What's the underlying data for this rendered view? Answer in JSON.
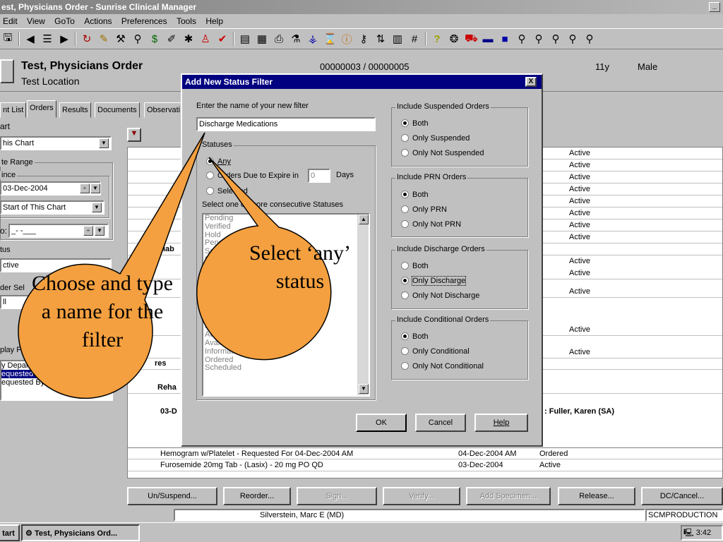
{
  "window": {
    "title": "est, Physicians Order - Sunrise Clinical Manager",
    "close_glyph": "_"
  },
  "menu": [
    "Edit",
    "View",
    "GoTo",
    "Actions",
    "Preferences",
    "Tools",
    "Help"
  ],
  "toolbar_icons": [
    "save-icon",
    "back-icon",
    "list-icon",
    "forward-icon",
    "refresh-icon",
    "edit-icon",
    "tools-icon",
    "search-icon",
    "money-icon",
    "pencil-icon",
    "star-icon",
    "person-icon",
    "check-icon",
    "table-icon",
    "grid-icon",
    "printer-icon",
    "flask-icon",
    "chart-icon",
    "timer-icon",
    "info-icon",
    "key-icon",
    "sort-icon",
    "calc-icon",
    "hash-icon",
    "help-icon",
    "pill-icon",
    "truck-icon",
    "card-icon",
    "computer-icon",
    "wrench-icon"
  ],
  "patient": {
    "name": "Test, Physicians Order",
    "location": "Test Location",
    "mrn": "00000003 / 00000005",
    "age": "11y",
    "sex": "Male"
  },
  "tabs": [
    "nt List",
    "Orders",
    "Results",
    "Documents",
    "Observati"
  ],
  "left_panel": {
    "chart_label": "art",
    "chart_value": "his Chart",
    "date_range_label": "te Range",
    "since_label": "ince",
    "since_date": "03-Dec-2004",
    "start_value": "Start of This Chart",
    "to_label": "o:",
    "to_value": "_-  -___",
    "status_label": "tus",
    "status_value": "ctive",
    "order_sel_label": "der Sel",
    "order_sel_value": "ll",
    "display_label": "play For",
    "display_items": [
      "y Departme",
      "equested By",
      "equested By details"
    ]
  },
  "grid": {
    "statuses": [
      "Active",
      "Active",
      "Active",
      "Active",
      "Active",
      "Active",
      "Active",
      "Active",
      "Active",
      "Active",
      "Active",
      "Active",
      "Active"
    ],
    "diab_label": "Diab",
    "reha_label": "Reha",
    "date_label": "03-D",
    "res_label": "res",
    "requested_by": ":   Fuller, Karen (SA)",
    "orders": [
      {
        "name": "Hemogram w/Platelet - Requested For 04-Dec-2004 AM",
        "date": "04-Dec-2004 AM",
        "status": "Ordered"
      },
      {
        "name": "Furosemide  20mg Tab - (Lasix) - 20 mg PO QD",
        "date": "03-Dec-2004",
        "status": "Active"
      }
    ]
  },
  "buttons": [
    "Un/Suspend...",
    "Reorder...",
    "Sign...",
    "Verify...",
    "Add Specimen...",
    "Release...",
    "DC/Cancel..."
  ],
  "statusbar": {
    "user": "Silverstein, Marc E (MD)",
    "env": "SCMPRODUCTION"
  },
  "taskbar": {
    "start": "tart",
    "task": "Test, Physicians Ord...",
    "clock": "3:42"
  },
  "dialog": {
    "title": "Add New Status Filter",
    "close": "X",
    "name_prompt": "Enter the name of your new filter",
    "name_value": "Discharge Medications",
    "statuses_label": "Statuses",
    "opt_any": "Any",
    "opt_expire": "Orders Due to Expire in",
    "expire_days": "0",
    "days_label": "Days",
    "opt_selected": "Selected",
    "select_hint": "Select one or more consecutive Statuses",
    "status_list": [
      "Pending",
      "Verified",
      "Hold",
      "Pending",
      "Schedule",
      "Pending",
      "Active",
      "Active C",
      "Active M",
      "Auto Activ",
      "Auto Activ",
      "Auto Activate",
      "Auto Activate",
      "Auto Activate Sta",
      "Auto Activate Status 8",
      "Available for Activation",
      "Information Only",
      "Ordered",
      "Scheduled"
    ],
    "suspended_group": {
      "label": "Include Suspended Orders",
      "options": [
        "Both",
        "Only Suspended",
        "Only Not Suspended"
      ],
      "selected": 0
    },
    "prn_group": {
      "label": "Include PRN Orders",
      "options": [
        "Both",
        "Only PRN",
        "Only Not PRN"
      ],
      "selected": 0
    },
    "discharge_group": {
      "label": "Include Discharge Orders",
      "options": [
        "Both",
        "Only Discharge",
        "Only Not Discharge"
      ],
      "selected": 1
    },
    "conditional_group": {
      "label": "Include Conditional Orders",
      "options": [
        "Both",
        "Only Conditional",
        "Only Not Conditional"
      ],
      "selected": 0
    },
    "ok": "OK",
    "cancel": "Cancel",
    "help": "Help"
  },
  "callouts": {
    "left": "Choose and type a name for the filter",
    "right": "Select ‘any’ status",
    "color": "#f4a040"
  }
}
